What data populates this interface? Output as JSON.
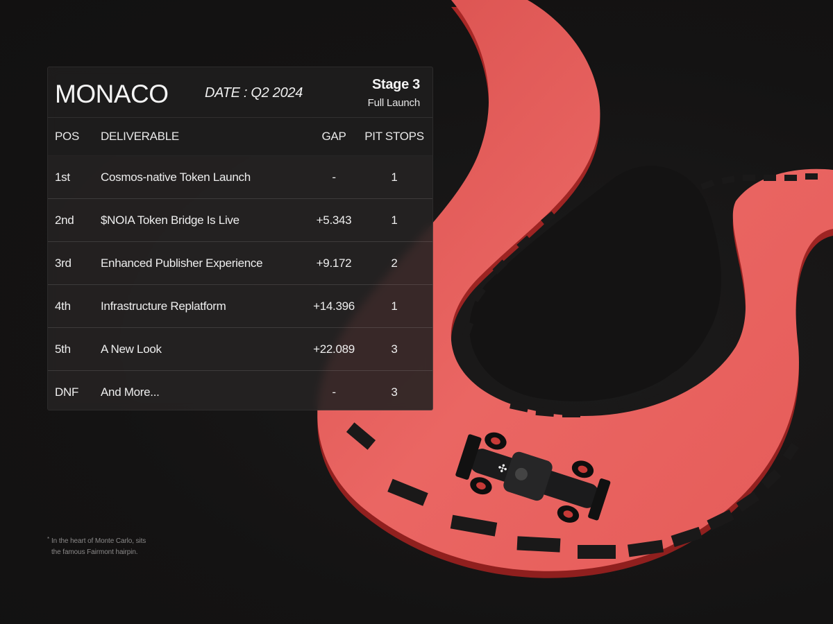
{
  "panel": {
    "title": "MONACO",
    "date": "DATE : Q2 2024",
    "stage": "Stage 3",
    "stage_sub": "Full Launch"
  },
  "columns": {
    "pos": "POS",
    "deliverable": "DELIVERABLE",
    "gap": "GAP",
    "pit_stops": "PIT STOPS"
  },
  "rows": [
    {
      "pos": "1st",
      "deliverable": "Cosmos-native Token Launch",
      "gap": "-",
      "pit_stops": "1"
    },
    {
      "pos": "2nd",
      "deliverable": "$NOIA Token Bridge Is Live",
      "gap": "+5.343",
      "pit_stops": "1"
    },
    {
      "pos": "3rd",
      "deliverable": "Enhanced Publisher Experience",
      "gap": "+9.172",
      "pit_stops": "2"
    },
    {
      "pos": "4th",
      "deliverable": "Infrastructure Replatform",
      "gap": "+14.396",
      "pit_stops": "1"
    },
    {
      "pos": "5th",
      "deliverable": "A New Look",
      "gap": "+22.089",
      "pit_stops": "3"
    },
    {
      "pos": "DNF",
      "deliverable": "And More...",
      "gap": "-",
      "pit_stops": "3"
    }
  ],
  "footnote": {
    "mark": "*",
    "line1": "In the heart of Monte Carlo, sits",
    "line2": "the famous Fairmont hairpin."
  },
  "colors": {
    "background": "#151414",
    "track": "#e8605d",
    "track_edge": "#b32e2c",
    "kerb": "#1a1919",
    "panel": "#201f1f"
  },
  "icons": {
    "track": "race-track-illustration",
    "car": "race-car-illustration"
  }
}
